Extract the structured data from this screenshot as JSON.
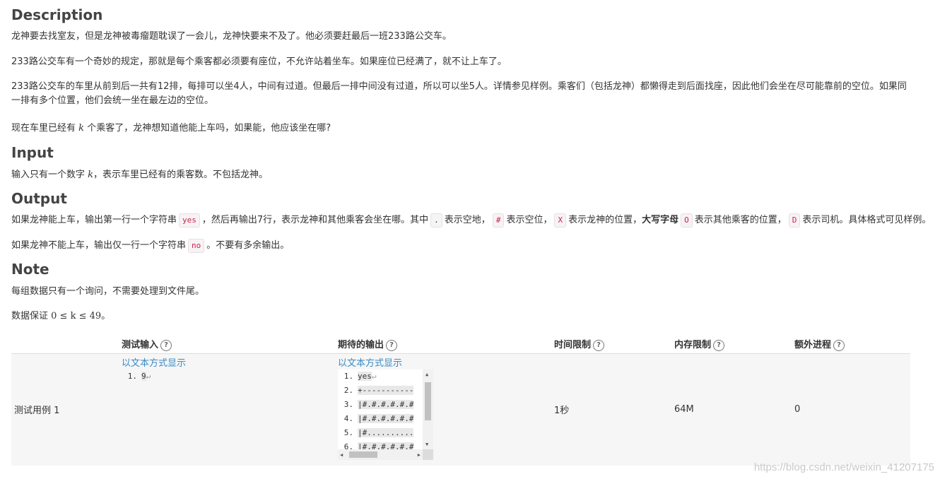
{
  "description": {
    "heading": "Description",
    "p1": "龙神要去找室友，但是龙神被毒瘤题耽误了一会儿，龙神快要来不及了。他必须要赶最后一班233路公交车。",
    "p2": "233路公交车有一个奇妙的规定，那就是每个乘客都必须要有座位，不允许站着坐车。如果座位已经满了，就不让上车了。",
    "p3": "233路公交车的车里从前到后一共有12排，每排可以坐4人，中间有过道。但最后一排中间没有过道，所以可以坐5人。详情参见样例。乘客们（包括龙神）都懒得走到后面找座，因此他们会坐在尽可能靠前的空位。如果同一排有多个位置，他们会统一坐在最左边的空位。",
    "p4_a": "现在车里已经有",
    "p4_k": "k",
    "p4_b": "个乘客了，龙神想知道他能上车吗，如果能，他应该坐在哪?"
  },
  "input": {
    "heading": "Input",
    "p1_a": "输入只有一个数字",
    "p1_k": "k",
    "p1_b": "，表示车里已经有的乘客数。不包括龙神。"
  },
  "output": {
    "heading": "Output",
    "p1_a": "如果龙神能上车，输出第一行一个字符串",
    "p1_yes": "yes",
    "p1_b": "，然后再输出7行，表示龙神和其他乘客会坐在哪。其中",
    "p1_dot": ".",
    "p1_c": "表示空地，",
    "p1_hash": "#",
    "p1_d": "表示空位，",
    "p1_x": "X",
    "p1_e": "表示龙神的位置，",
    "p1_bold": "大写字母",
    "p1_o": "O",
    "p1_f": "表示其他乘客的位置，",
    "p1_dd": "D",
    "p1_g": "表示司机。具体格式可见样例。",
    "p2_a": "如果龙神不能上车，输出仅一行一个字符串",
    "p2_no": "no",
    "p2_b": "。不要有多余输出。"
  },
  "note": {
    "heading": "Note",
    "p1": "每组数据只有一个询问，不需要处理到文件尾。",
    "p2_a": "数据保证",
    "p2_math": "0 ≤ k ≤ 49",
    "p2_b": "。"
  },
  "table": {
    "headers": {
      "test_input": "测试输入",
      "expected_output": "期待的输出",
      "time_limit": "时间限制",
      "memory_limit": "内存限制",
      "extra_process": "额外进程"
    },
    "row": {
      "name": "测试用例 1",
      "input_link": "以文本方式显示",
      "input_lines": [
        {
          "n": "1.",
          "text": "9"
        }
      ],
      "output_link": "以文本方式显示",
      "output_lines": [
        {
          "n": "1.",
          "text": "yes"
        },
        {
          "n": "2.",
          "text": "+-----------"
        },
        {
          "n": "3.",
          "text": "|#.#.#.#.#.#"
        },
        {
          "n": "4.",
          "text": "|#.#.#.#.#.#"
        },
        {
          "n": "5.",
          "text": "|#.........."
        },
        {
          "n": "6.",
          "text": "|#.#.#.#.#.#"
        }
      ],
      "time": "1秒",
      "memory": "64M",
      "extra": "0"
    },
    "help_glyph": "?"
  },
  "watermark": "https://blog.csdn.net/weixin_41207175"
}
